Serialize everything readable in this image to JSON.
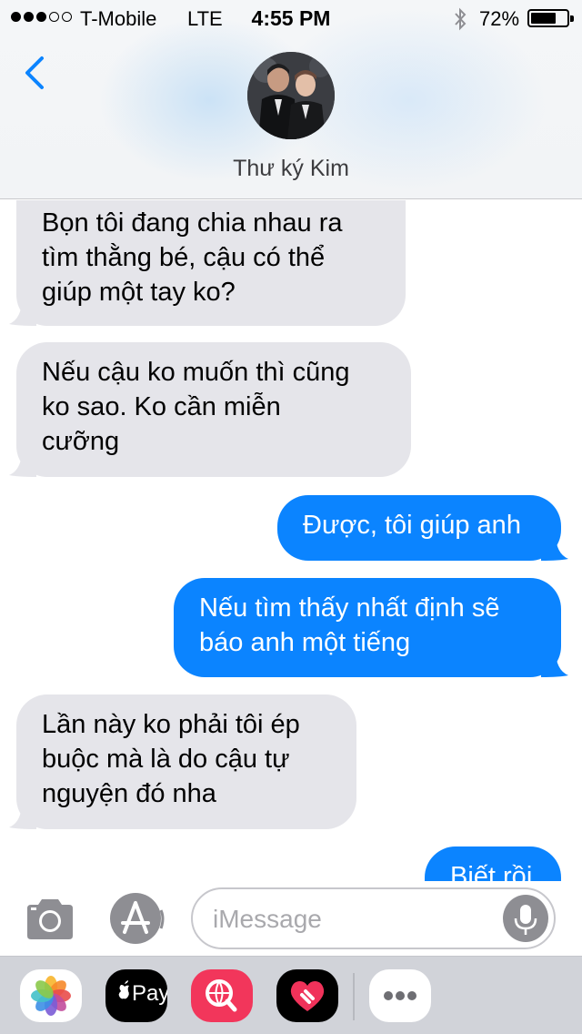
{
  "status_bar": {
    "carrier": "T-Mobile",
    "network": "LTE",
    "time": "4:55 PM",
    "battery_percent": "72%",
    "battery_level": 0.72,
    "signal_bars_filled": 3,
    "signal_bars_total": 5
  },
  "header": {
    "back_icon": "chevron-left-icon",
    "contact_name": "Thư ký Kim",
    "accent_color": "#0b84ff"
  },
  "messages": [
    {
      "direction": "incoming",
      "lines": [
        "Bọn tôi đang chia nhau ra",
        "tìm thằng bé, cậu có thể",
        "giúp một tay ko?"
      ]
    },
    {
      "direction": "incoming",
      "lines": [
        "Nếu cậu ko muốn thì cũng",
        "ko sao. Ko cần miễn",
        "cưỡng"
      ]
    },
    {
      "direction": "outgoing",
      "lines": [
        "Được, tôi giúp anh"
      ]
    },
    {
      "direction": "outgoing",
      "lines": [
        "Nếu tìm thấy nhất định sẽ",
        "báo anh một tiếng"
      ]
    },
    {
      "direction": "incoming",
      "lines": [
        "Lần này ko phải tôi ép",
        "buộc mà là do cậu tự",
        "nguyện đó nha"
      ]
    },
    {
      "direction": "outgoing",
      "lines": [
        "Biết rồi"
      ]
    }
  ],
  "input_bar": {
    "placeholder": "iMessage",
    "camera_icon": "camera-icon",
    "appstore_icon": "app-store-icon",
    "mic_icon": "microphone-icon"
  },
  "app_drawer": {
    "apps": [
      {
        "name": "photos-app-icon"
      },
      {
        "name": "apple-pay-app-icon",
        "label": "Pay"
      },
      {
        "name": "search-images-app-icon"
      },
      {
        "name": "digital-touch-app-icon"
      },
      {
        "name": "more-apps-icon"
      }
    ]
  },
  "colors": {
    "incoming_bubble": "#e5e5ea",
    "outgoing_bubble": "#0b84ff"
  }
}
